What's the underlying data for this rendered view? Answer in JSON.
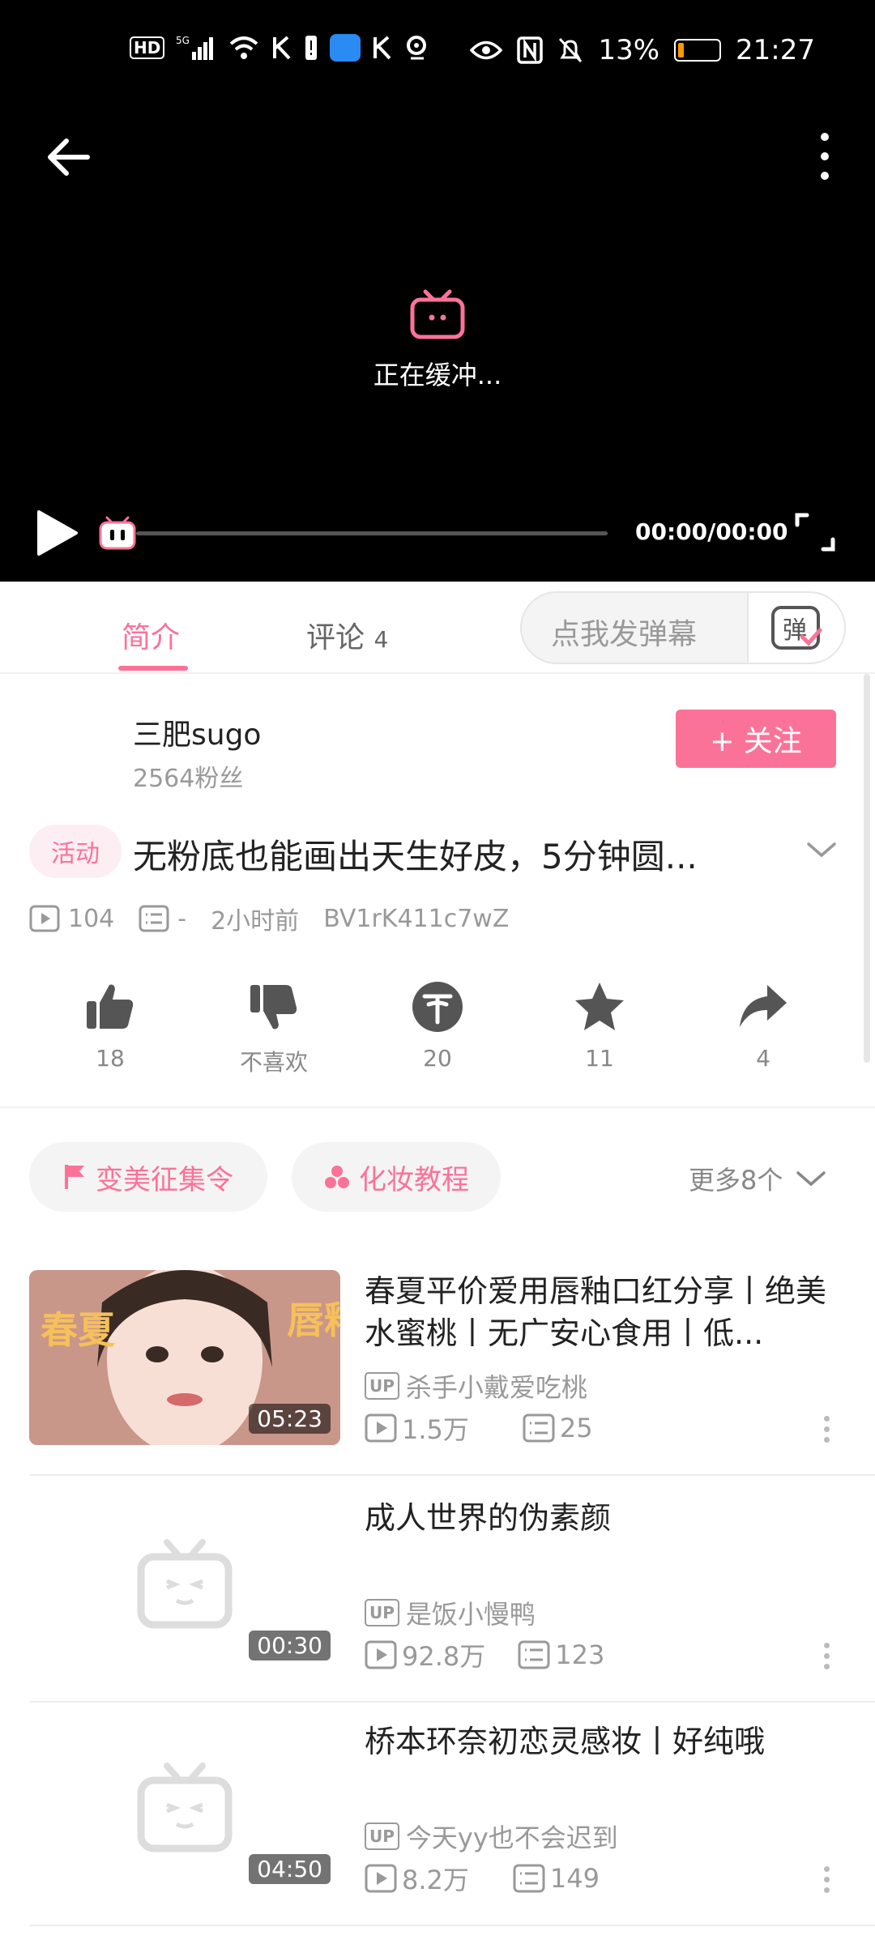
{
  "status_bar": {
    "left_icons": [
      "hd-icon",
      "5g-signal-icon",
      "wifi-icon",
      "k-app-icon",
      "alert-icon",
      "cloud-app-icon",
      "k-app-icon",
      "location-icon"
    ],
    "hd": "HD",
    "battery_pct": "13%",
    "battery_level": 0.13,
    "time": "21:27"
  },
  "player": {
    "buffering_text": "正在缓冲...",
    "time": "00:00/00:00",
    "progress": 0
  },
  "tabs": [
    {
      "label": "简介",
      "active": true
    },
    {
      "label": "评论",
      "count": "4",
      "active": false
    }
  ],
  "danmaku": {
    "placeholder": "点我发弹幕",
    "button": "弹"
  },
  "uploader": {
    "name": "三肥sugo",
    "fans": "2564粉丝",
    "follow_label": "+ 关注"
  },
  "video": {
    "badge": "活动",
    "title": "无粉底也能画出天生好皮，5分钟圆...",
    "views": "104",
    "danmaku_count": "-",
    "time_ago": "2小时前",
    "bvid": "BV1rK411c7wZ"
  },
  "actions": [
    {
      "icon": "thumbs-up-icon",
      "label": "18"
    },
    {
      "icon": "thumbs-down-icon",
      "label": "不喜欢"
    },
    {
      "icon": "coin-icon",
      "label": "20"
    },
    {
      "icon": "star-icon",
      "label": "11"
    },
    {
      "icon": "share-icon",
      "label": "4"
    }
  ],
  "tags": [
    {
      "icon": "flag-icon",
      "label": "变美征集令"
    },
    {
      "icon": "circles-icon",
      "label": "化妆教程"
    }
  ],
  "more_tags": "更多8个",
  "related": [
    {
      "title": "春夏平价爱用唇釉口红分享丨绝美水蜜桃丨无广安心食用丨低...",
      "up_badge": "UP",
      "uploader": "杀手小戴爱吃桃",
      "views": "1.5万",
      "danmaku": "25",
      "duration": "05:23",
      "thumb_text_left": "春夏",
      "thumb_text_right": "唇釉"
    },
    {
      "title": "成人世界的伪素颜",
      "up_badge": "UP",
      "uploader": "是饭小慢鸭",
      "views": "92.8万",
      "danmaku": "123",
      "duration": "00:30"
    },
    {
      "title": "桥本环奈初恋灵感妆丨好纯哦",
      "up_badge": "UP",
      "uploader": "今天yy也不会迟到",
      "views": "8.2万",
      "danmaku": "149",
      "duration": "04:50"
    }
  ],
  "colors": {
    "accent": "#fb7299",
    "battery": "#ff9a00"
  }
}
